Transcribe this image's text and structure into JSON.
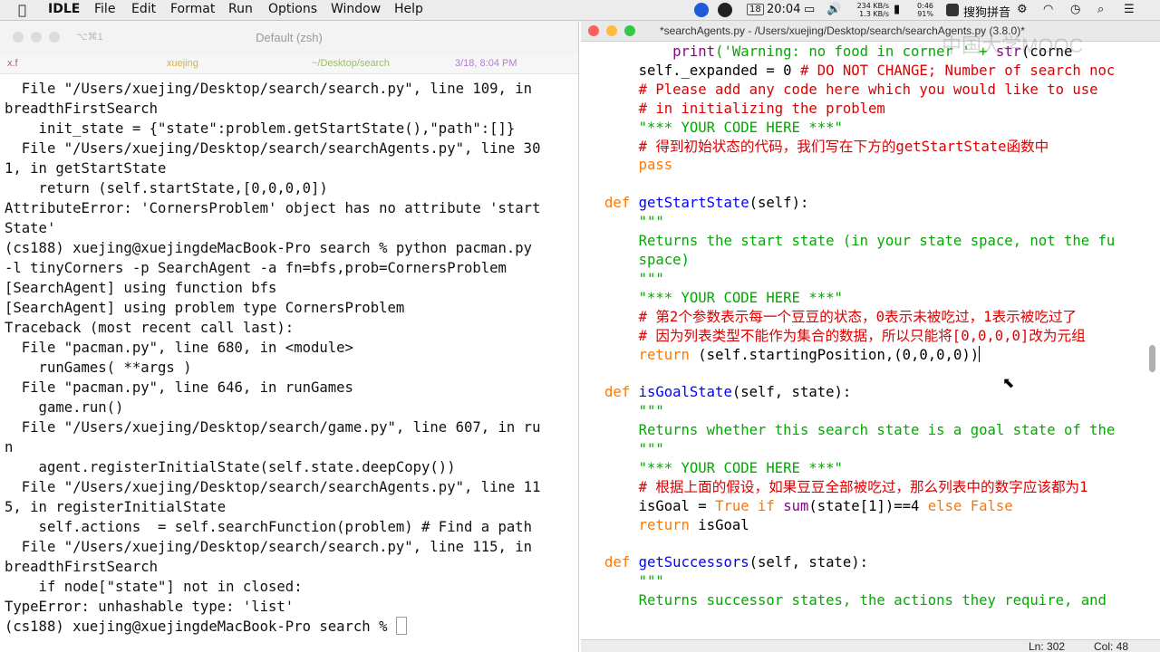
{
  "menubar": {
    "app_name": "IDLE",
    "items": [
      "File",
      "Edit",
      "Format",
      "Run",
      "Options",
      "Window",
      "Help"
    ],
    "calendar_day": "18",
    "clock": "20:04",
    "net_up": "234 KB/s",
    "net_down": "1.3 KB/s",
    "battery_time": "0:46",
    "battery_pct": "91%",
    "ime_label": "搜狗拼音"
  },
  "terminal": {
    "title": "Default (zsh)",
    "keys_hint": "⌥⌘1",
    "tabs": [
      "x.f",
      "xuejing",
      "~/Desktop/search",
      "3/18, 8:04 PM"
    ],
    "output": [
      "  File \"/Users/xuejing/Desktop/search/search.py\", line 109, in",
      "breadthFirstSearch",
      "    init_state = {\"state\":problem.getStartState(),\"path\":[]}",
      "  File \"/Users/xuejing/Desktop/search/searchAgents.py\", line 30",
      "1, in getStartState",
      "    return (self.startState,[0,0,0,0])",
      "AttributeError: 'CornersProblem' object has no attribute 'start",
      "State'",
      "(cs188) xuejing@xuejingdeMacBook-Pro search % python pacman.py",
      "-l tinyCorners -p SearchAgent -a fn=bfs,prob=CornersProblem",
      "[SearchAgent] using function bfs",
      "[SearchAgent] using problem type CornersProblem",
      "Traceback (most recent call last):",
      "  File \"pacman.py\", line 680, in <module>",
      "    runGames( **args )",
      "  File \"pacman.py\", line 646, in runGames",
      "    game.run()",
      "  File \"/Users/xuejing/Desktop/search/game.py\", line 607, in ru",
      "n",
      "    agent.registerInitialState(self.state.deepCopy())",
      "  File \"/Users/xuejing/Desktop/search/searchAgents.py\", line 11",
      "5, in registerInitialState",
      "    self.actions  = self.searchFunction(problem) # Find a path",
      "  File \"/Users/xuejing/Desktop/search/search.py\", line 115, in",
      "breadthFirstSearch",
      "    if node[\"state\"] not in closed:",
      "TypeError: unhashable type: 'list'"
    ],
    "prompt": "(cs188) xuejing@xuejingdeMacBook-Pro search % "
  },
  "editor": {
    "title": "*searchAgents.py - /Users/xuejing/Desktop/search/searchAgents.py (3.8.0)*",
    "watermark": "中国大学MOOC",
    "status": {
      "line": "Ln: 302",
      "col": "Col: 48"
    },
    "code": {
      "l1_print": "print",
      "l1_str": "('Warning: no food in corner ' + ",
      "l1_str_fn": "str",
      "l1_tail": "(corne",
      "l2_code": "self._expanded = 0 ",
      "l2_comment": "# DO NOT CHANGE; Number of search noc",
      "l3_comment": "# Please add any code here which you would like to use",
      "l4_comment": "# in initializing the problem",
      "l5_str": "\"*** YOUR CODE HERE ***\"",
      "l6_comment": "# 得到初始状态的代码，我们写在下方的getStartState函数中",
      "l7_kw": "pass",
      "def1_kw": "def",
      "def1_name": "getStartState",
      "def1_args": "(self):",
      "d1_doc1": "\"\"\"",
      "d1_doc2": "Returns the start state (in your state space, not the fu",
      "d1_doc3": "space)",
      "d1_doc4": "\"\"\"",
      "d1_str": "\"*** YOUR CODE HERE ***\"",
      "d1_cm1": "# 第2个参数表示每一个豆豆的状态，0表示未被吃过，1表示被吃过了",
      "d1_cm2": "# 因为列表类型不能作为集合的数据，所以只能将[0,0,0,0]改为元组",
      "d1_ret_kw": "return",
      "d1_ret_expr": " (self.startingPosition,(0,0,0,0))",
      "def2_kw": "def",
      "def2_name": "isGoalState",
      "def2_args": "(self, state):",
      "d2_doc1": "\"\"\"",
      "d2_doc2": "Returns whether this search state is a goal state of the",
      "d2_doc3": "\"\"\"",
      "d2_str": "\"*** YOUR CODE HERE ***\"",
      "d2_cm": "# 根据上面的假设，如果豆豆全部被吃过，那么列表中的数字应该都为1",
      "d2_a1": "isGoal = ",
      "d2_a2": "True",
      "d2_a3": " ",
      "d2_a4": "if",
      "d2_a5": " ",
      "d2_a6": "sum",
      "d2_a7": "(state[1])==4 ",
      "d2_a8": "else",
      "d2_a9": " ",
      "d2_a10": "False",
      "d2_ret_kw": "return",
      "d2_ret_expr": " isGoal",
      "def3_kw": "def",
      "def3_name": "getSuccessors",
      "def3_args": "(self, state):",
      "d3_doc1": "\"\"\"",
      "d3_doc2": "Returns successor states, the actions they require, and"
    }
  }
}
